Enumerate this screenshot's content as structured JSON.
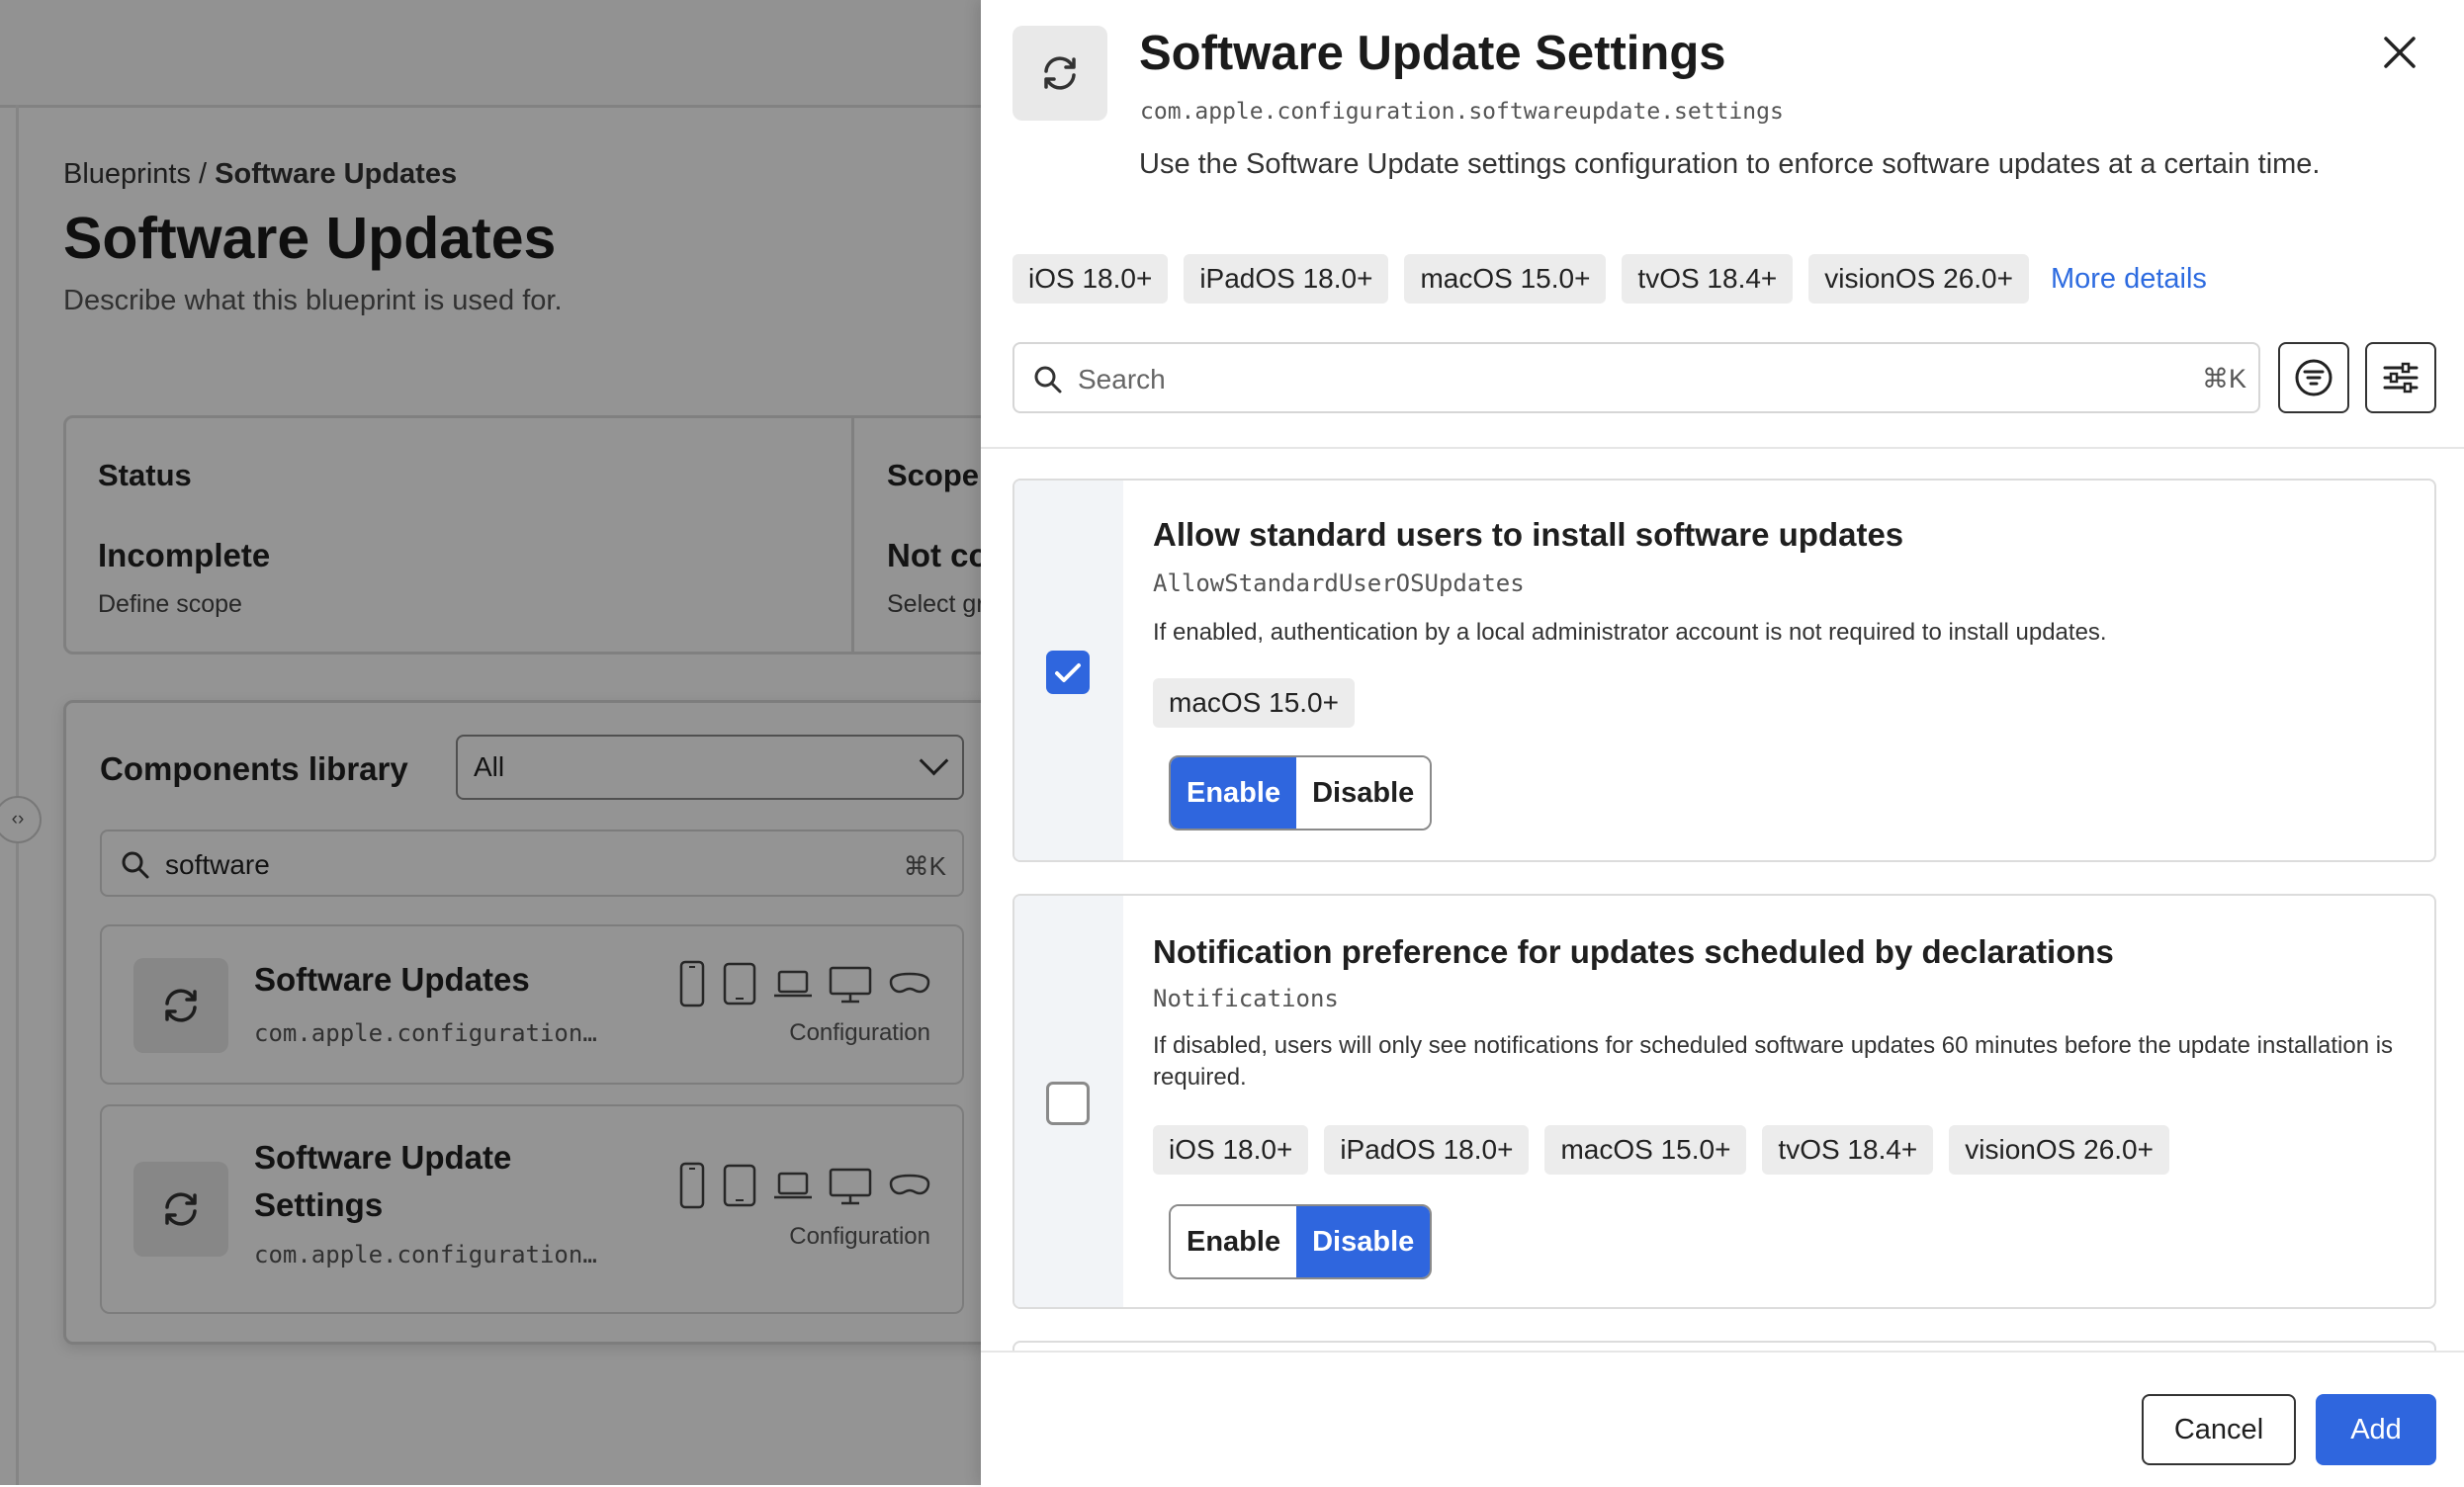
{
  "background": {
    "breadcrumb_parent": "Blueprints",
    "breadcrumb_sep": " / ",
    "breadcrumb_current": "Software Updates",
    "title": "Software Updates",
    "description": "Describe what this blueprint is used for.",
    "status": {
      "heading": "Status",
      "value": "Incomplete",
      "sub": "Define scope"
    },
    "scope": {
      "heading": "Scope",
      "value": "Not co",
      "sub": "Select gr"
    },
    "components": {
      "title": "Components library",
      "filter_value": "All",
      "search_value": "software",
      "search_shortcut": "⌘K",
      "items": [
        {
          "name": "Software Updates",
          "id": "com.apple.configuration…",
          "type": "Configuration"
        },
        {
          "name": "Software Update Settings",
          "id": "com.apple.configuration…",
          "type": "Configuration"
        }
      ]
    }
  },
  "drawer": {
    "title": "Software Update Settings",
    "identifier": "com.apple.configuration.softwareupdate.settings",
    "description": "Use the Software Update settings configuration to enforce software updates at a certain time.",
    "platforms": [
      "iOS 18.0+",
      "iPadOS 18.0+",
      "macOS 15.0+",
      "tvOS 18.4+",
      "visionOS 26.0+"
    ],
    "more_details": "More details",
    "search_placeholder": "Search",
    "search_shortcut": "⌘K",
    "settings": [
      {
        "title": "Allow standard users to install software updates",
        "key": "AllowStandardUserOSUpdates",
        "description": "If enabled, authentication by a local administrator account is not required to install updates.",
        "platforms": [
          "macOS 15.0+"
        ],
        "checked": true,
        "enable_label": "Enable",
        "disable_label": "Disable",
        "selected": "Enable"
      },
      {
        "title": "Notification preference for updates scheduled by declarations",
        "key": "Notifications",
        "description": "If disabled, users will only see notifications for scheduled software updates 60 minutes before the update installation is required.",
        "platforms": [
          "iOS 18.0+",
          "iPadOS 18.0+",
          "macOS 15.0+",
          "tvOS 18.4+",
          "visionOS 26.0+"
        ],
        "checked": false,
        "enable_label": "Enable",
        "disable_label": "Disable",
        "selected": "Disable"
      }
    ],
    "cancel_label": "Cancel",
    "add_label": "Add"
  },
  "colors": {
    "accent": "#2f66de",
    "tag_bg": "#ececec",
    "overlay": "rgba(0,0,0,0.42)"
  }
}
